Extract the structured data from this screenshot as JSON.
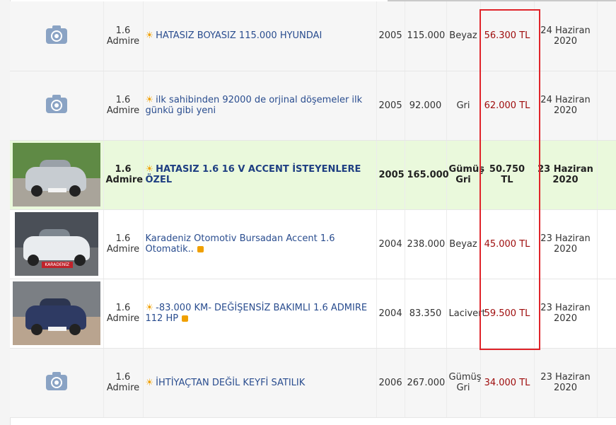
{
  "listings": [
    {
      "model": "1.6 Admire",
      "title": "HATASIZ BOYASIZ 115.000 HYUNDAI",
      "year": "2005",
      "km": "115.000",
      "color": "Beyaz",
      "price": "56.300 TL",
      "date": "24 Haziran 2020",
      "photo": "camera-placeholder-icon"
    },
    {
      "model": "1.6 Admire",
      "title": "ilk sahibinden 92000 de orjinal döşemeler ilk günkü gibi yeni",
      "year": "2005",
      "km": "92.000",
      "color": "Gri",
      "price": "62.000 TL",
      "date": "24 Haziran 2020",
      "photo": "camera-placeholder-icon"
    },
    {
      "model": "1.6 Admire",
      "title": "HATASIZ 1.6 16 V ACCENT İSTEYENLERE ÖZEL",
      "year": "2005",
      "km": "165.000",
      "color": "Gümüş Gri",
      "price": "50.750 TL",
      "date": "23 Haziran 2020",
      "photo": "silver-sedan-photo"
    },
    {
      "model": "1.6 Admire",
      "title": "Karadeniz Otomotiv Bursadan Accent 1.6 Otomatik..",
      "year": "2004",
      "km": "238.000",
      "color": "Beyaz",
      "price": "45.000 TL",
      "date": "23 Haziran 2020",
      "photo": "white-car-front-photo",
      "plate_text": "KARADENİZ"
    },
    {
      "model": "1.6 Admire",
      "title": "-83.000 KM- DEĞİŞENSİZ BAKIMLI 1.6 ADMIRE 112 HP",
      "year": "2004",
      "km": "83.350",
      "color": "Lacivert",
      "price": "59.500 TL",
      "date": "23 Haziran 2020",
      "photo": "navy-sedan-photo"
    },
    {
      "model": "1.6 Admire",
      "title": "İHTİYAÇTAN DEĞİL KEYFİ SATILIK",
      "year": "2006",
      "km": "267.000",
      "color": "Gümüş Gri",
      "price": "34.000 TL",
      "date": "23 Haziran 2020",
      "photo": "camera-placeholder-icon"
    }
  ],
  "highlight": {
    "color": "#e0242a",
    "target": "price-column"
  },
  "colors": {
    "price": "#9e0b0b",
    "link": "#2a4d8f",
    "featured_row": "#eaf9dc",
    "badge": "#f0a000"
  }
}
